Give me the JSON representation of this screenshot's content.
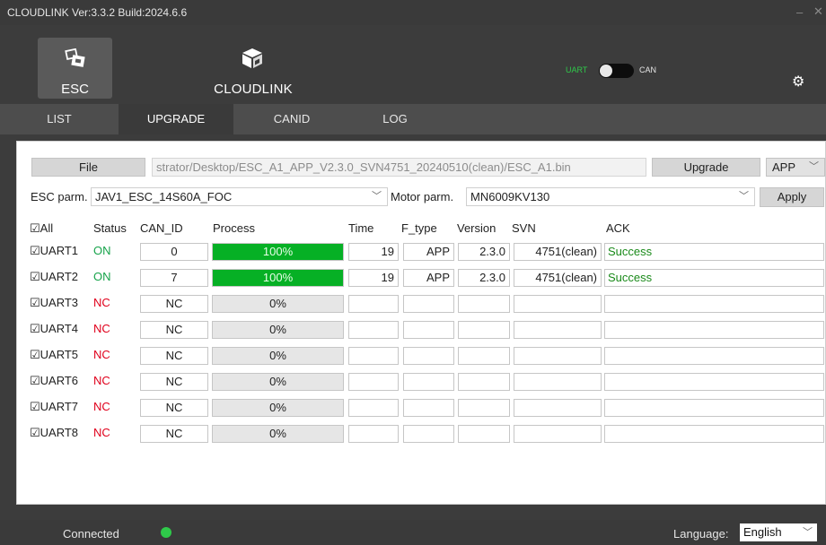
{
  "window": {
    "title": "CLOUDLINK   Ver:3.3.2  Build:2024.6.6",
    "minimize": "–",
    "close": "✕"
  },
  "header": {
    "esc_label": "ESC",
    "esc_icon": "esc-modules-icon",
    "cloudlink_label": "CLOUDLINK",
    "cloudlink_icon": "box-icon",
    "toggle_left": "UART",
    "toggle_right": "CAN",
    "toggle_state": "UART",
    "settings_icon": "gear-icon"
  },
  "tabs": [
    {
      "label": "LIST",
      "active": false
    },
    {
      "label": "UPGRADE",
      "active": true
    },
    {
      "label": "CANID",
      "active": false
    },
    {
      "label": "LOG",
      "active": false
    }
  ],
  "upgrade": {
    "file_button": "File",
    "file_path": "strator/Desktop/ESC_A1_APP_V2.3.0_SVN4751_20240510(clean)/ESC_A1.bin",
    "upgrade_button": "Upgrade",
    "fw_type_value": "APP",
    "esc_parm_label": "ESC parm.",
    "esc_parm_value": "JAV1_ESC_14S60A_FOC",
    "motor_parm_label": "Motor parm.",
    "motor_parm_value": "MN6009KV130",
    "apply_button": "Apply"
  },
  "table": {
    "headers": {
      "all": "☑All",
      "status": "Status",
      "can_id": "CAN_ID",
      "process": "Process",
      "time": "Time",
      "f_type": "F_type",
      "version": "Version",
      "svn": "SVN",
      "ack": "ACK"
    },
    "rows": [
      {
        "name": "☑UART1",
        "status": "ON",
        "can_id": "0",
        "process": "100%",
        "progress": 1.0,
        "time": "19",
        "f_type": "APP",
        "version": "2.3.0",
        "svn": "4751(clean)",
        "ack": "Success"
      },
      {
        "name": "☑UART2",
        "status": "ON",
        "can_id": "7",
        "process": "100%",
        "progress": 1.0,
        "time": "19",
        "f_type": "APP",
        "version": "2.3.0",
        "svn": "4751(clean)",
        "ack": "Success"
      },
      {
        "name": "☑UART3",
        "status": "NC",
        "can_id": "NC",
        "process": "0%",
        "progress": 0.0,
        "time": "",
        "f_type": "",
        "version": "",
        "svn": "",
        "ack": ""
      },
      {
        "name": "☑UART4",
        "status": "NC",
        "can_id": "NC",
        "process": "0%",
        "progress": 0.0,
        "time": "",
        "f_type": "",
        "version": "",
        "svn": "",
        "ack": ""
      },
      {
        "name": "☑UART5",
        "status": "NC",
        "can_id": "NC",
        "process": "0%",
        "progress": 0.0,
        "time": "",
        "f_type": "",
        "version": "",
        "svn": "",
        "ack": ""
      },
      {
        "name": "☑UART6",
        "status": "NC",
        "can_id": "NC",
        "process": "0%",
        "progress": 0.0,
        "time": "",
        "f_type": "",
        "version": "",
        "svn": "",
        "ack": ""
      },
      {
        "name": "☑UART7",
        "status": "NC",
        "can_id": "NC",
        "process": "0%",
        "progress": 0.0,
        "time": "",
        "f_type": "",
        "version": "",
        "svn": "",
        "ack": ""
      },
      {
        "name": "☑UART8",
        "status": "NC",
        "can_id": "NC",
        "process": "0%",
        "progress": 0.0,
        "time": "",
        "f_type": "",
        "version": "",
        "svn": "",
        "ack": ""
      }
    ]
  },
  "status_bar": {
    "connection": "Connected",
    "connection_color": "#2fc94a",
    "language_label": "Language:",
    "language_value": "English"
  },
  "colors": {
    "progress_fill": "#06b025",
    "status_on": "#16a34a",
    "status_nc": "#e0001b",
    "ack_success": "#1a8a1a"
  }
}
